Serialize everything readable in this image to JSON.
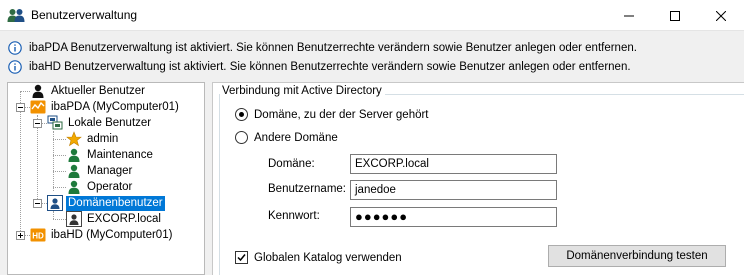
{
  "window": {
    "title": "Benutzerverwaltung",
    "icon": "users-icon"
  },
  "info": [
    "ibaPDA Benutzerverwaltung ist aktiviert. Sie können Benutzerrechte verändern sowie Benutzer anlegen oder entfernen.",
    "ibaHD Benutzerverwaltung ist aktiviert. Sie können Benutzerrechte verändern sowie Benutzer anlegen oder entfernen."
  ],
  "tree": {
    "current_user": "Aktueller Benutzer",
    "ibapda": "ibaPDA (MyComputer01)",
    "local_users": "Lokale Benutzer",
    "users": [
      "admin",
      "Maintenance",
      "Manager",
      "Operator"
    ],
    "domain_users": "Domänenbenutzer",
    "domain": "EXCORP.local",
    "ibahd": "ibaHD (MyComputer01)"
  },
  "ad": {
    "group_title": "Verbindung mit Active Directory",
    "radio_server_domain": "Domäne, zu der der Server gehört",
    "radio_other_domain": "Andere Domäne",
    "domain_label": "Domäne:",
    "domain_value": "EXCORP.local",
    "username_label": "Benutzername:",
    "username_value": "janedoe",
    "password_label": "Kennwort:",
    "password_value": "●●●●●●",
    "global_catalog_label": "Globalen Katalog verwenden",
    "test_button": "Domänenverbindung testen"
  },
  "colors": {
    "selection": "#0078d7",
    "ibapda_orange": "#f29100",
    "user_green": "#1e7a3c",
    "admin_gold": "#f2a900",
    "info_blue": "#1a5fb4"
  }
}
